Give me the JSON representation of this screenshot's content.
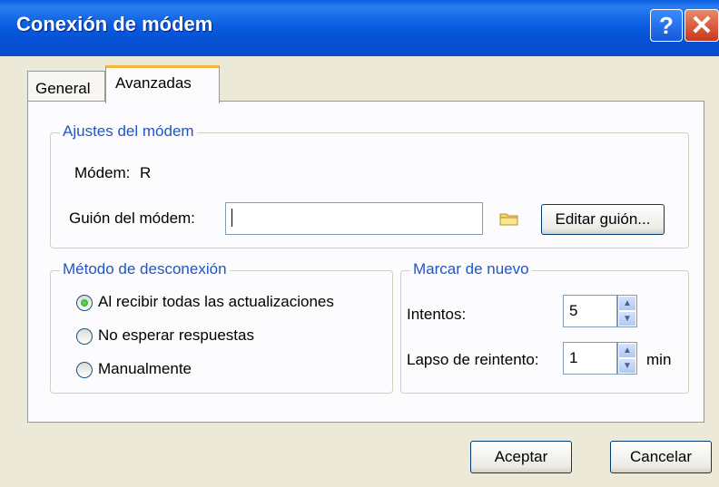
{
  "window": {
    "title": "Conexión de módem",
    "help_glyph": "?",
    "close_glyph": "✕"
  },
  "tabs": [
    {
      "label": "General"
    },
    {
      "label": "Avanzadas"
    }
  ],
  "modem_settings": {
    "legend": "Ajustes del módem",
    "modem_label": "Módem:",
    "modem_value": "R",
    "script_label": "Guión del módem:",
    "script_value": "",
    "edit_button": "Editar guión..."
  },
  "disconnect": {
    "legend": "Método de desconexión",
    "options": [
      {
        "label": "Al recibir todas las actualizaciones",
        "selected": true
      },
      {
        "label": "No esperar respuestas",
        "selected": false
      },
      {
        "label": "Manualmente",
        "selected": false
      }
    ]
  },
  "redial": {
    "legend": "Marcar de nuevo",
    "attempts_label": "Intentos:",
    "attempts_value": "5",
    "interval_label": "Lapso de reintento:",
    "interval_value": "1",
    "interval_unit": "min"
  },
  "buttons": {
    "ok": "Aceptar",
    "cancel": "Cancelar"
  },
  "colors": {
    "title_bar": "#0a5ee0",
    "accent_legend": "#1e56c8",
    "tab_highlight": "#f5b53e"
  }
}
